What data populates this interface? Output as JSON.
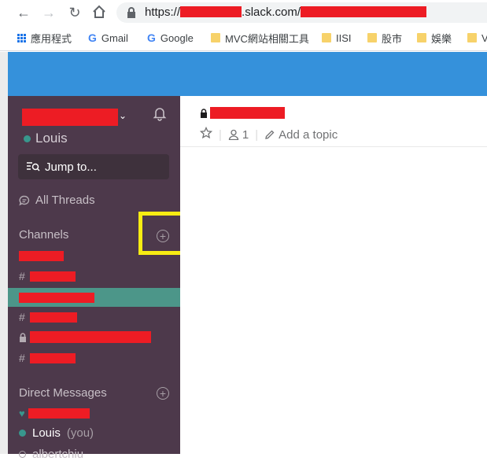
{
  "browser": {
    "url_prefix": "https://",
    "url_domain": ".slack.com/",
    "bookmarks": [
      {
        "label": "應用程式",
        "icon": "apps-grid-icon"
      },
      {
        "label": "Gmail",
        "icon": "google-icon"
      },
      {
        "label": "Google",
        "icon": "google-icon"
      },
      {
        "label": "MVC網站相關工具",
        "icon": "folder-icon"
      },
      {
        "label": "IISI",
        "icon": "folder-icon"
      },
      {
        "label": "股市",
        "icon": "folder-icon"
      },
      {
        "label": "娛樂",
        "icon": "folder-icon"
      },
      {
        "label": "V",
        "icon": "folder-icon"
      }
    ]
  },
  "sidebar": {
    "user_name": "Louis",
    "jump_to": "Jump to...",
    "all_threads": "All Threads",
    "channels_header": "Channels",
    "channel_hash": "#",
    "dm_header": "Direct Messages",
    "dm_self_name": "Louis",
    "dm_self_suffix": "(you)",
    "dm_partial": "albertchiu"
  },
  "channel": {
    "member_count": "1",
    "add_topic": "Add a topic"
  },
  "colors": {
    "sidebar_bg": "#4d394b",
    "topbar_bg": "#3591db",
    "active_channel": "#4c9689",
    "highlight_box": "#f7ec13",
    "redaction": "#ed1c24"
  }
}
